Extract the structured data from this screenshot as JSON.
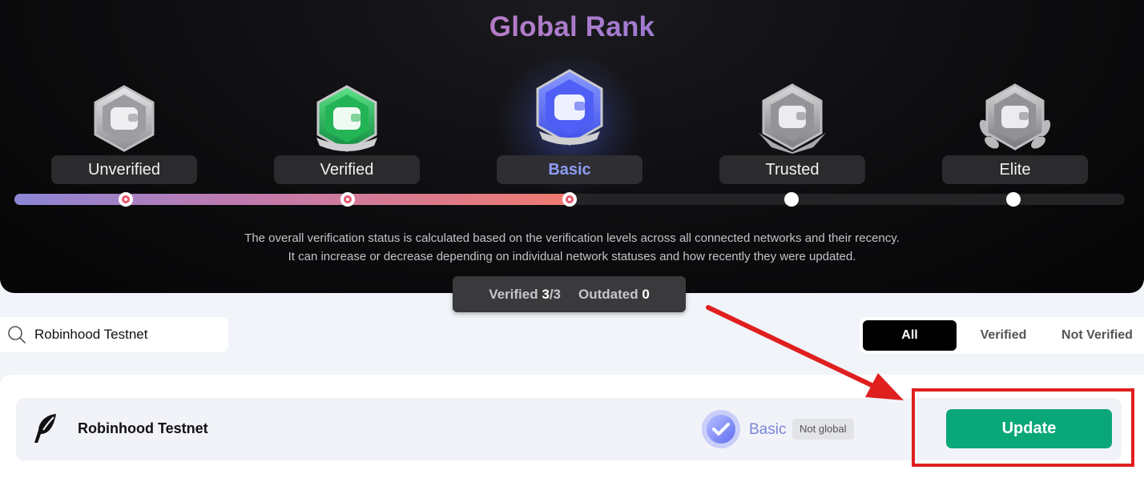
{
  "rank": {
    "title": "Global Rank",
    "tiers": [
      {
        "label": "Unverified",
        "state": "done"
      },
      {
        "label": "Verified",
        "state": "done"
      },
      {
        "label": "Basic",
        "state": "current"
      },
      {
        "label": "Trusted",
        "state": "todo"
      },
      {
        "label": "Elite",
        "state": "todo"
      }
    ],
    "progress_fraction": 0.5,
    "description_line1": "The overall verification status is calculated based on the verification levels across all connected networks and their recency.",
    "description_line2": "It can increase or decrease depending on individual network statuses and how recently they were updated."
  },
  "summary": {
    "verified_label": "Verified",
    "verified_count": "3",
    "verified_total": "/3",
    "outdated_label": "Outdated",
    "outdated_count": "0"
  },
  "search": {
    "value": "Robinhood Testnet",
    "icon": "search-icon"
  },
  "filters": [
    {
      "label": "All",
      "active": true
    },
    {
      "label": "Verified",
      "active": false
    },
    {
      "label": "Not Verified",
      "active": false
    }
  ],
  "networks": [
    {
      "name": "Robinhood Testnet",
      "level": "Basic",
      "tag": "Not global",
      "action": "Update"
    }
  ],
  "colors": {
    "accent_green": "#0aa879",
    "basic_blue": "#7a86d8",
    "annotation_red": "#e01f1f"
  }
}
